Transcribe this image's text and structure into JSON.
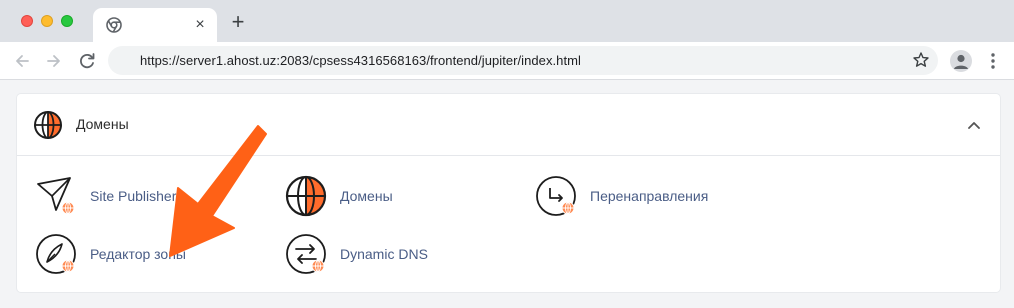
{
  "browser": {
    "tab_close_glyph": "×",
    "newtab_glyph": "+",
    "url": "https://server1.ahost.uz:2083/cpsess4316568163/frontend/jupiter/index.html"
  },
  "section": {
    "title": "Домены",
    "items": [
      {
        "label": "Site Publisher",
        "icon": "site-publisher-icon"
      },
      {
        "label": "Домены",
        "icon": "domains-globe-icon"
      },
      {
        "label": "Перенаправления",
        "icon": "redirects-icon"
      },
      {
        "label": "Редактор зоны",
        "icon": "zone-editor-icon"
      },
      {
        "label": "Dynamic DNS",
        "icon": "dynamic-dns-icon"
      }
    ]
  },
  "colors": {
    "accent_orange": "#ff6c2c",
    "link_blue": "#4a5d86"
  }
}
